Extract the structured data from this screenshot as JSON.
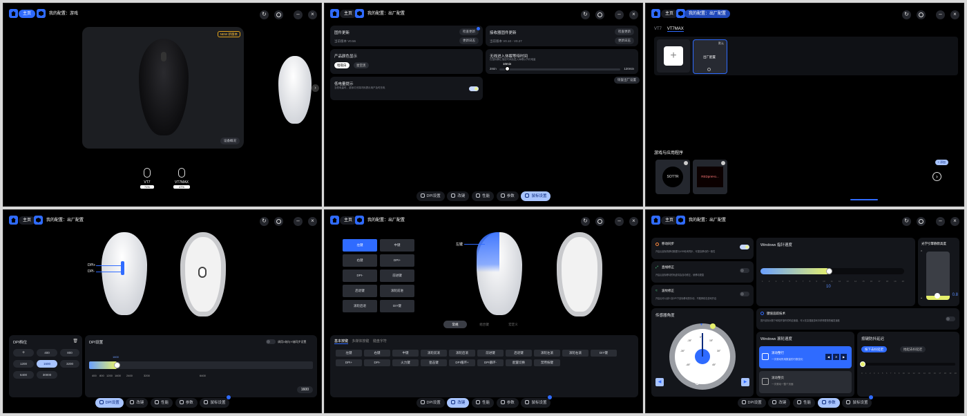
{
  "topbar": {
    "home": "主页",
    "cfg_game": "我的配置：游戏",
    "cfg_factory": "我的配置：出厂配置"
  },
  "nav": {
    "dpi": "DPI设置",
    "keys": "改键",
    "perf": "性能",
    "params": "参数",
    "mouse": "鼠标设置"
  },
  "p1": {
    "new_badge": "NEW 新版本",
    "overview": "设备概况",
    "devices": [
      {
        "name": "VT7",
        "battery": "71%"
      },
      {
        "name": "VT7MAX",
        "battery": "47%"
      }
    ]
  },
  "p2": {
    "fw": {
      "title": "固件更新",
      "check": "检查更新",
      "version": "当前版本 V0.56",
      "log": "更新日志"
    },
    "rx": {
      "title": "接收器固件更新",
      "check": "检查更新",
      "version": "当前版本 V0.10 - V0.27",
      "log": "更新日志"
    },
    "color": {
      "title": "产品颜色显示",
      "opt1": "暗夜白",
      "opt2": "星空黑"
    },
    "sleep": {
      "title": "无线进入休眠等待时间",
      "sub": "在鼠标静止指定时间后进入休眠以节约电量",
      "value": "10min",
      "min": "2min",
      "max": "120min"
    },
    "lowbat": {
      "title": "低电量提示",
      "sub": "当低电量时，鼠标灯光将闪烁提示用户及时充电"
    },
    "reset": "恢复出厂设置"
  },
  "p3": {
    "tabs": [
      "VT7",
      "VT7MAX"
    ],
    "default": "默认",
    "factory_cfg": "出厂配置",
    "games_title": "游戏与应用程序",
    "add": "+ 添加",
    "games": [
      "SOTTR",
      "REDpreHo..."
    ]
  },
  "p4": {
    "dpi_plus": "DPI+",
    "dpi_minus": "DPI-",
    "stage_title": "DPI档位",
    "stages": [
      "400",
      "800",
      "1200",
      "1600",
      "3200",
      "6400",
      "30000"
    ],
    "set_title": "DPI设置",
    "sync": "调用X轴与Y轴同步设置",
    "current": "1600",
    "ticks": [
      "400",
      "800",
      "1200",
      "1600",
      "2400",
      "3200",
      "6400"
    ],
    "value_box": "1600"
  },
  "p5": {
    "left_keys": [
      "左键",
      "右键",
      "DPI-",
      "后退键",
      "滚轮后退"
    ],
    "right_keys": [
      "中键",
      "DPI+",
      "前进键",
      "滚轮前进",
      "DIY键"
    ],
    "callout": "左键",
    "modes": [
      "常规",
      "组合键",
      "宏定义"
    ],
    "tabs": [
      "基本按键",
      "多媒体按键",
      "键盘字符"
    ],
    "row1": [
      "左键",
      "右键",
      "中键",
      "滚轮前滚",
      "滚轮后滚",
      "前进键",
      "后退键",
      "滚轮左滚",
      "滚轮右滚",
      "DIY键"
    ],
    "row2": [
      "DPI+",
      "DPI-",
      "火力键",
      "狙击键",
      "DPI循环+",
      "DPI循环-",
      "配置切换",
      "禁用按键"
    ]
  },
  "p6": {
    "motion_sync": {
      "title": "移动同步",
      "sub": "开启后鼠标的移动数据与USB轮询同步，可提高移动的一致性"
    },
    "ripple": {
      "title": "直线修正",
      "sub": "开启后鼠标移动的轨迹将会自动修正，使移动更直"
    },
    "angle_fix": {
      "title": "波纹修正",
      "sub": "开启后可以减少高DPI下鼠标移动的抖动，不推荐射击游戏开启"
    },
    "pointer_speed": {
      "title": "Windows 指针速度",
      "value": "10"
    },
    "lod": {
      "title": "光学引擎静默高度",
      "value": "0.8"
    },
    "angle": {
      "title": "传感器角度",
      "value": "0°"
    },
    "angle_ticks": [
      "0°",
      "15°",
      "-15°",
      "30°",
      "-30°",
      "-45°",
      "45°"
    ],
    "precise": {
      "title": "键值追踪技术",
      "sub": "提升鼠标对按下和松开操作的响应速度，可以在高强度游戏中获得更快的触发速度"
    },
    "scroll": {
      "title": "Windows 滚轮速度",
      "opt1_title": "滚动整行",
      "opt1_sub": "一次滚动所用数量的行数变化",
      "opt1_val": "3",
      "opt2_title": "滚动整页",
      "opt2_sub": "一次滚动一整个页面"
    },
    "debounce": {
      "title": "按键防抖延迟",
      "opt1": "按下去抖延迟",
      "opt2": "抬起去抖延迟"
    },
    "scale": [
      "0",
      "1",
      "2",
      "3",
      "4",
      "5",
      "6",
      "7",
      "8",
      "9",
      "10",
      "11",
      "12",
      "13",
      "14",
      "15",
      "16",
      "17",
      "18",
      "19",
      "20"
    ]
  },
  "colors": {
    "accent": "#2f6bff",
    "yellow": "#e6f06c"
  }
}
